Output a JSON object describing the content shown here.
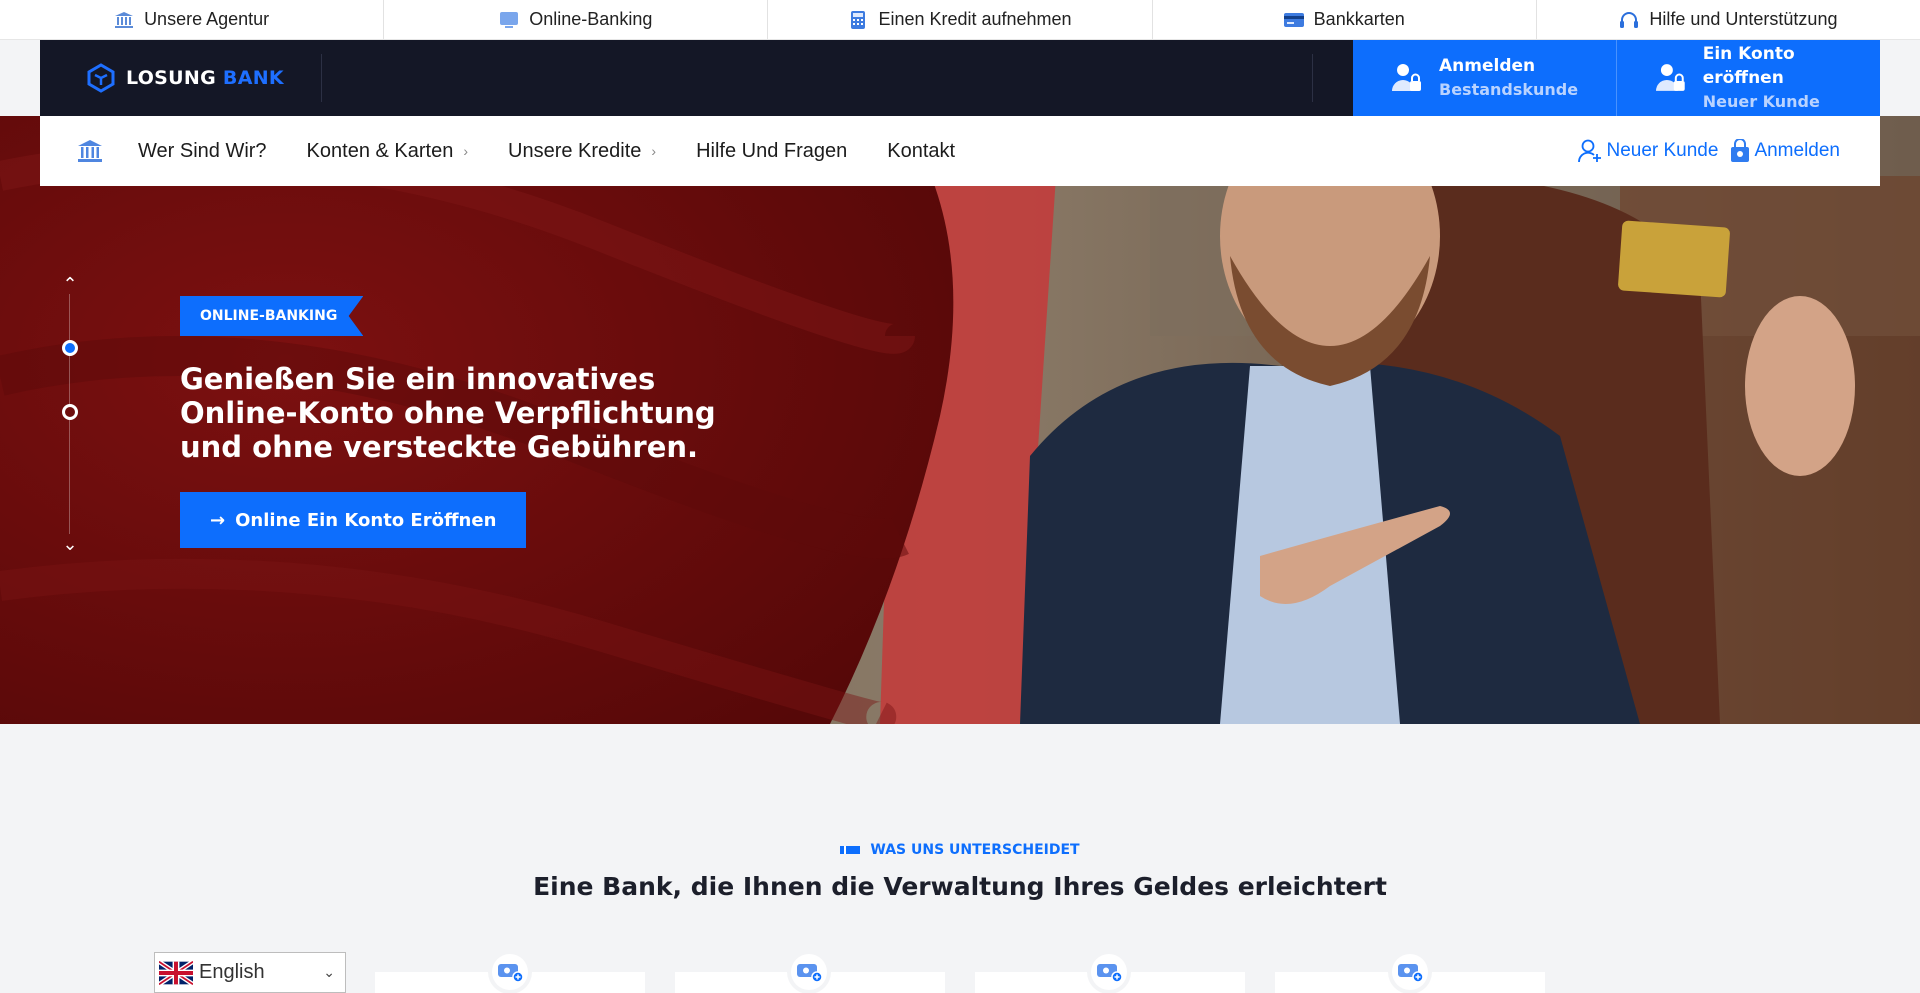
{
  "topbar": {
    "items": [
      {
        "label": "Unsere Agentur",
        "icon": "bank-icon"
      },
      {
        "label": "Online-Banking",
        "icon": "monitor-icon"
      },
      {
        "label": "Einen Kredit aufnehmen",
        "icon": "calculator-icon"
      },
      {
        "label": "Bankkarten",
        "icon": "credit-card-icon"
      },
      {
        "label": "Hilfe und Unterstützung",
        "icon": "headset-icon"
      }
    ]
  },
  "header": {
    "logo_main": "LOSUNG",
    "logo_accent": " BANK",
    "login": {
      "title": "Anmelden",
      "subtitle": "Bestandskunde"
    },
    "open_account": {
      "title": "Ein Konto eröffnen",
      "subtitle": "Neuer Kunde"
    }
  },
  "nav": {
    "items": [
      "Wer Sind Wir?",
      "Konten & Karten",
      "Unsere Kredite",
      "Hilfe Und Fragen",
      "Kontakt"
    ],
    "chevron": "›",
    "new_customer": "Neuer Kunde",
    "login": "Anmelden"
  },
  "hero": {
    "tag": "ONLINE-BANKING",
    "title": "Genießen Sie ein innovatives Online-Konto ohne Verpflichtung und ohne versteckte Gebühren.",
    "button": "Online Ein Konto Eröffnen",
    "button_arrow": "→",
    "slider_up": "⌃",
    "slider_down": "⌄"
  },
  "section": {
    "eyebrow": "WAS UNS UNTERSCHEIDET",
    "title": "Eine Bank, die Ihnen die Verwaltung Ihres Geldes erleichtert"
  },
  "language": {
    "selected": "English",
    "chevron": "⌄"
  },
  "colors": {
    "primary": "#0d6efd",
    "dark": "#141726",
    "hero_red": "#6e0d0d"
  }
}
